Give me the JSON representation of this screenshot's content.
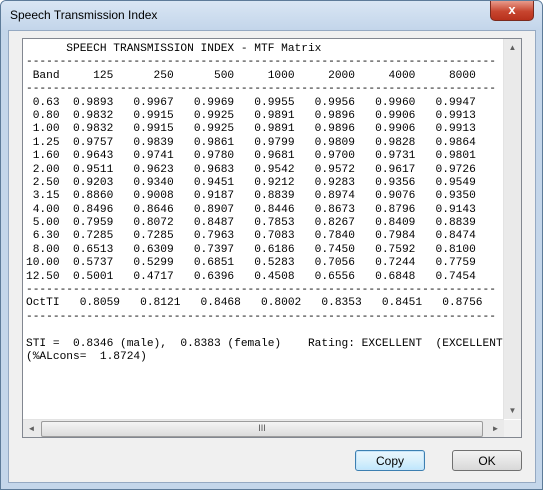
{
  "window": {
    "title": "Speech Transmission Index",
    "close_glyph": "x"
  },
  "report": {
    "lines": [
      "      SPEECH TRANSMISSION INDEX - MTF Matrix",
      "----------------------------------------------------------------------",
      " Band     125      250      500     1000     2000     4000     8000",
      "----------------------------------------------------------------------",
      " 0.63  0.9893   0.9967   0.9969   0.9955   0.9956   0.9960   0.9947",
      " 0.80  0.9832   0.9915   0.9925   0.9891   0.9896   0.9906   0.9913",
      " 1.00  0.9832   0.9915   0.9925   0.9891   0.9896   0.9906   0.9913",
      " 1.25  0.9757   0.9839   0.9861   0.9799   0.9809   0.9828   0.9864",
      " 1.60  0.9643   0.9741   0.9780   0.9681   0.9700   0.9731   0.9801",
      " 2.00  0.9511   0.9623   0.9683   0.9542   0.9572   0.9617   0.9726",
      " 2.50  0.9203   0.9340   0.9451   0.9212   0.9283   0.9356   0.9549",
      " 3.15  0.8860   0.9008   0.9187   0.8839   0.8974   0.9076   0.9350",
      " 4.00  0.8496   0.8646   0.8907   0.8446   0.8673   0.8796   0.9143",
      " 5.00  0.7959   0.8072   0.8487   0.7853   0.8267   0.8409   0.8839",
      " 6.30  0.7285   0.7285   0.7963   0.7083   0.7840   0.7984   0.8474",
      " 8.00  0.6513   0.6309   0.7397   0.6186   0.7450   0.7592   0.8100",
      "10.00  0.5737   0.5299   0.6851   0.5283   0.7056   0.7244   0.7759",
      "12.50  0.5001   0.4717   0.6396   0.4508   0.6556   0.6848   0.7454",
      "----------------------------------------------------------------------",
      "OctTI   0.8059   0.8121   0.8468   0.8002   0.8353   0.8451   0.8756",
      "----------------------------------------------------------------------",
      "",
      "STI =  0.8346 (male),  0.8383 (female)    Rating: EXCELLENT  (EXCELLENT)",
      "(%ALcons=  1.8724)"
    ]
  },
  "scrollbar": {
    "up_glyph": "▲",
    "down_glyph": "▼",
    "left_glyph": "◄",
    "right_glyph": "►",
    "thumb_grip": "III"
  },
  "buttons": {
    "copy_label": "Copy",
    "ok_label": "OK"
  }
}
